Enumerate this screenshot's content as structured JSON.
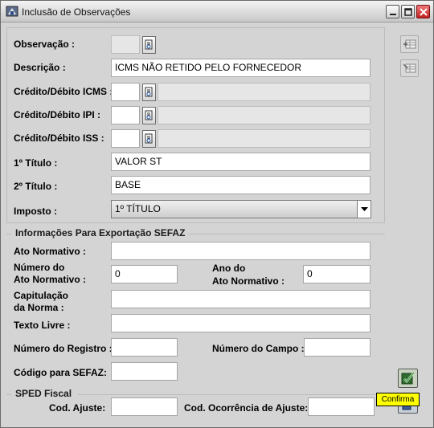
{
  "window": {
    "title": "Inclusão de Observações"
  },
  "form": {
    "observacao": {
      "label": "Observação :",
      "value": ""
    },
    "descricao": {
      "label": "Descrição :",
      "value": "ICMS NÃO RETIDO PELO FORNECEDOR"
    },
    "credito_icms": {
      "label": "Crédito/Débito ICMS :",
      "code": "",
      "desc": ""
    },
    "credito_ipi": {
      "label": "Crédito/Débito IPI :",
      "code": "",
      "desc": ""
    },
    "credito_iss": {
      "label": "Crédito/Débito ISS :",
      "code": "",
      "desc": ""
    },
    "titulo1": {
      "label": "1º Título :",
      "value": "VALOR ST"
    },
    "titulo2": {
      "label": "2º Título :",
      "value": "BASE"
    },
    "imposto": {
      "label": "Imposto :",
      "value": "1º TÍTULO"
    }
  },
  "sefaz": {
    "section_title": "Informações Para Exportação SEFAZ",
    "ato_normativo": {
      "label": "Ato Normativo :",
      "value": ""
    },
    "numero_ato": {
      "label_line1": "Número do",
      "label_line2": "Ato Normativo :",
      "value": "0"
    },
    "ano_ato": {
      "label_line1": "Ano do",
      "label_line2": "Ato Normativo :",
      "value": "0"
    },
    "capitulacao": {
      "label_line1": "Capitulação",
      "label_line2": "da Norma :",
      "value": ""
    },
    "texto_livre": {
      "label": "Texto Livre :",
      "value": ""
    },
    "numero_registro": {
      "label": "Número do Registro :",
      "value": ""
    },
    "numero_campo": {
      "label": "Número do Campo :",
      "value": ""
    },
    "codigo_sefaz": {
      "label": "Código para SEFAZ:",
      "value": ""
    }
  },
  "sped": {
    "section_title": "SPED Fiscal",
    "cod_ajuste": {
      "label": "Cod. Ajuste:",
      "value": ""
    },
    "cod_ocorrencia": {
      "label": "Cod. Ocorrência de Ajuste:",
      "value": ""
    }
  },
  "actions": {
    "confirm_tooltip": "Confirma"
  },
  "icons": {
    "app": "app-icon",
    "minimize": "minimize-icon",
    "maximize": "maximize-icon",
    "close": "close-icon",
    "lookup": "search-document-icon",
    "dropdown": "chevron-down-icon",
    "side1": "table-add-icon",
    "side2": "table-edit-icon",
    "confirm": "check-icon",
    "cancel": "exit-icon"
  },
  "colors": {
    "window_bg": "#d4d4d4",
    "tooltip_bg": "#ffff00",
    "close_button": "#c0201e"
  }
}
